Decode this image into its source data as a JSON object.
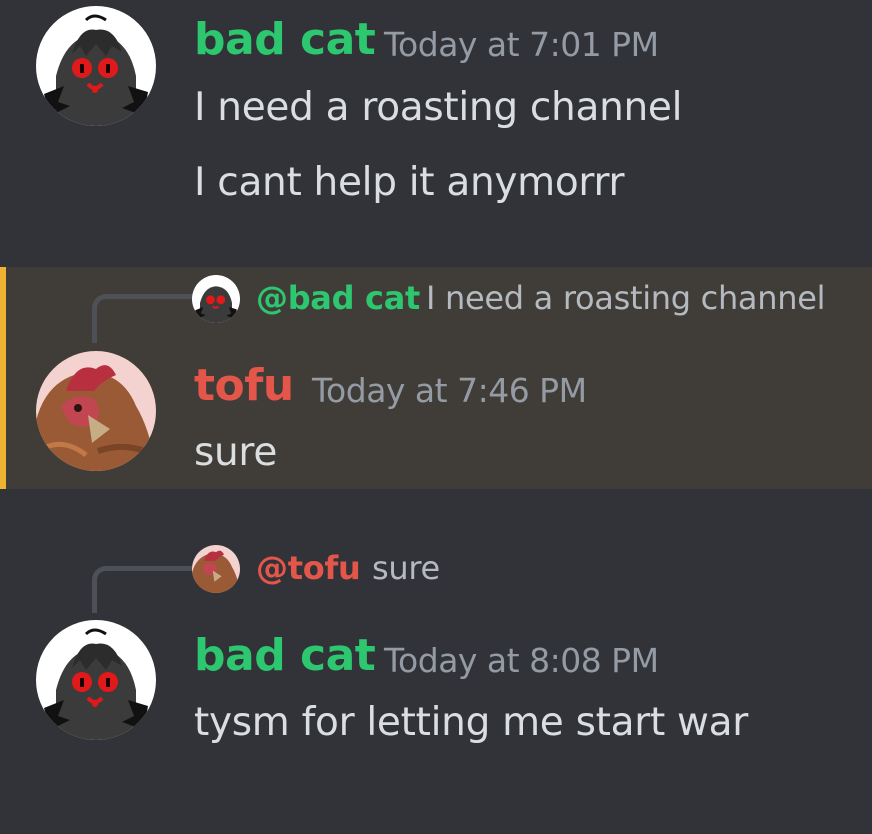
{
  "colors": {
    "background": "#313338",
    "highlight_bg": "#403d38",
    "highlight_bar": "#f0b232",
    "bad_cat_name": "#2dc770",
    "tofu_name": "#e5564a",
    "timestamp": "#949ba4",
    "message_text": "#dbdee1"
  },
  "messages": [
    {
      "author": "bad cat",
      "avatar_icon": "bad-cat-avatar",
      "timestamp": "Today at 7:01 PM",
      "lines": [
        "I need a roasting channel",
        "I cant help it anymorrr"
      ]
    },
    {
      "highlighted": true,
      "reply": {
        "mention": "@bad cat",
        "text": "I need a roasting channel",
        "avatar_icon": "bad-cat-avatar"
      },
      "author": "tofu",
      "avatar_icon": "chicken-avatar",
      "timestamp": "Today at 7:46 PM",
      "lines": [
        "sure"
      ]
    },
    {
      "reply": {
        "mention": "@tofu",
        "text": "sure",
        "avatar_icon": "chicken-avatar"
      },
      "author": "bad cat",
      "avatar_icon": "bad-cat-avatar",
      "timestamp": "Today at 8:08 PM",
      "lines": [
        "tysm for letting me start war"
      ]
    }
  ]
}
